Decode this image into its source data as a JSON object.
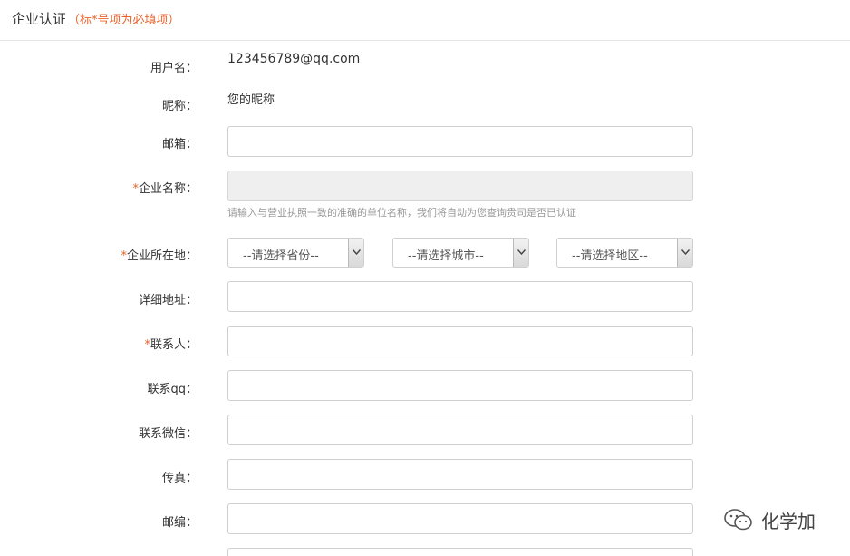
{
  "header": {
    "title": "企业认证",
    "note": "（标*号项为必填项）"
  },
  "form": {
    "username": {
      "label": "用户名：",
      "value": "123456789@qq.com"
    },
    "nickname": {
      "label": "昵称：",
      "value": "您的昵称"
    },
    "email": {
      "label": "邮箱：",
      "value": ""
    },
    "company_name": {
      "required": "*",
      "label": "企业名称：",
      "value": "",
      "hint": "请输入与营业执照一致的准确的单位名称，我们将自动为您查询贵司是否已认证"
    },
    "location": {
      "required": "*",
      "label": "企业所在地：",
      "province": "--请选择省份--",
      "city": "--请选择城市--",
      "district": "--请选择地区--"
    },
    "address": {
      "label": "详细地址：",
      "value": ""
    },
    "contact": {
      "required": "*",
      "label": "联系人：",
      "value": ""
    },
    "qq": {
      "label": "联系qq：",
      "value": ""
    },
    "wechat": {
      "label": "联系微信：",
      "value": ""
    },
    "fax": {
      "label": "传真：",
      "value": ""
    },
    "postcode": {
      "label": "邮编：",
      "value": ""
    }
  },
  "watermark": {
    "text": "化学加",
    "icon": "wechat-icon"
  }
}
